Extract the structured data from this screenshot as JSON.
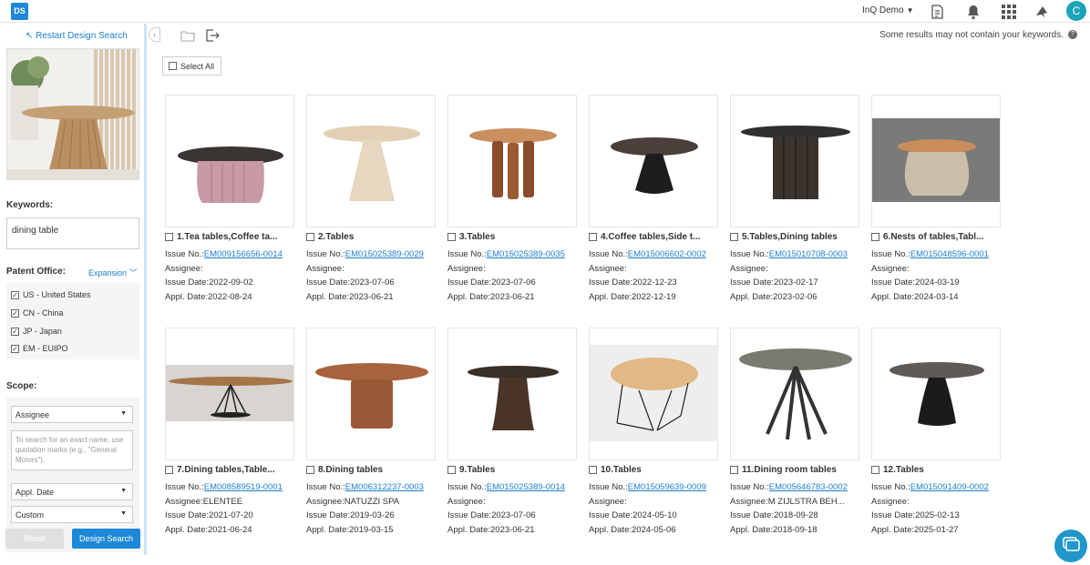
{
  "app": {
    "logo": "DS",
    "account_label": "InQ Demo",
    "avatar_letter": "C"
  },
  "sidebar": {
    "restart_label": "Restart Design Search",
    "keywords_label": "Keywords:",
    "keywords_value": "dining table",
    "patent_office_label": "Patent Office:",
    "expansion_label": "Expansion",
    "offices": [
      {
        "label": "US - United States",
        "checked": true
      },
      {
        "label": "CN - China",
        "checked": true
      },
      {
        "label": "JP - Japan",
        "checked": true
      },
      {
        "label": "EM - EUIPO",
        "checked": true
      }
    ],
    "scope_label": "Scope:",
    "scope_select": "Assignee",
    "scope_placeholder": "To search for an exact name, use quotation marks (e.g., \"General Motors\").",
    "date_select": "Appl. Date",
    "range_select": "Custom",
    "reset_label": "Reset",
    "search_label": "Design Search"
  },
  "toolbar": {
    "notice": "Some results may not contain your keywords.",
    "help": "?",
    "select_all": "Select All"
  },
  "field_labels": {
    "issue_no": "Issue No.:",
    "assignee": "Assignee:",
    "issue_date": "Issue Date:",
    "appl_date": "Appl. Date:"
  },
  "results": [
    {
      "title": "1.Tea tables,Coffee ta...",
      "issue_no": "EM009156656-0014",
      "assignee": "",
      "issue_date": "2022-09-02",
      "appl_date": "2022-08-24"
    },
    {
      "title": "2.Tables",
      "issue_no": "EM015025389-0029",
      "assignee": "",
      "issue_date": "2023-07-06",
      "appl_date": "2023-06-21"
    },
    {
      "title": "3.Tables",
      "issue_no": "EM015025389-0035",
      "assignee": "",
      "issue_date": "2023-07-06",
      "appl_date": "2023-06-21"
    },
    {
      "title": "4.Coffee tables,Side t...",
      "issue_no": "EM015006602-0002",
      "assignee": "",
      "issue_date": "2022-12-23",
      "appl_date": "2022-12-19"
    },
    {
      "title": "5.Tables,Dining tables",
      "issue_no": "EM015010708-0003",
      "assignee": "",
      "issue_date": "2023-02-17",
      "appl_date": "2023-02-06"
    },
    {
      "title": "6.Nests of tables,Tabl...",
      "issue_no": "EM015048596-0001",
      "assignee": "",
      "issue_date": "2024-03-19",
      "appl_date": "2024-03-14"
    },
    {
      "title": "7.Dining tables,Table...",
      "issue_no": "EM008589519-0001",
      "assignee": "ELENTEE",
      "issue_date": "2021-07-20",
      "appl_date": "2021-06-24"
    },
    {
      "title": "8.Dining tables",
      "issue_no": "EM006312237-0003",
      "assignee": "NATUZZI SPA",
      "issue_date": "2019-03-26",
      "appl_date": "2019-03-15"
    },
    {
      "title": "9.Tables",
      "issue_no": "EM015025389-0014",
      "assignee": "",
      "issue_date": "2023-07-06",
      "appl_date": "2023-06-21"
    },
    {
      "title": "10.Tables",
      "issue_no": "EM015059639-0009",
      "assignee": "",
      "issue_date": "2024-05-10",
      "appl_date": "2024-05-06"
    },
    {
      "title": "11.Dining room tables",
      "issue_no": "EM005646783-0002",
      "assignee": "M ZIJLSTRA BEH...",
      "issue_date": "2018-09-28",
      "appl_date": "2018-09-18"
    },
    {
      "title": "12.Tables",
      "issue_no": "EM015091409-0002",
      "assignee": "",
      "issue_date": "2025-02-13",
      "appl_date": "2025-01-27"
    }
  ]
}
